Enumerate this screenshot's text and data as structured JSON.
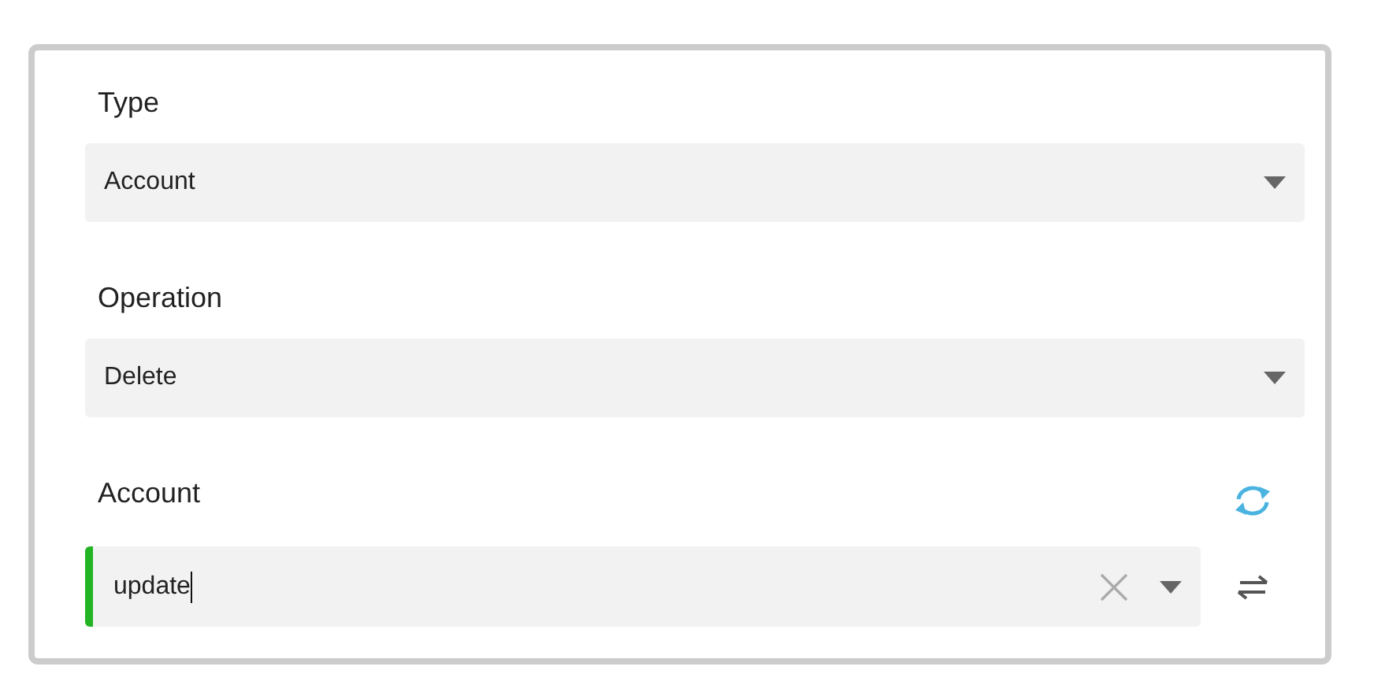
{
  "fields": [
    {
      "label": "Type",
      "kind": "select",
      "value": "Account"
    },
    {
      "label": "Operation",
      "kind": "select",
      "value": "Delete"
    },
    {
      "label": "Account",
      "kind": "lookup",
      "value": "update",
      "focused": true
    }
  ]
}
